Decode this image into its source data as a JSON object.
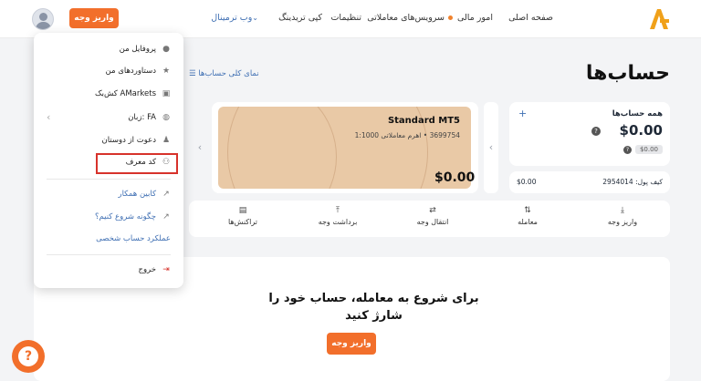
{
  "header": {
    "nav": [
      "صفحه اصلی",
      "امور مالی",
      "سرویس‌های معاملاتی",
      "تنظیمات",
      "کپی تریدینگ",
      "وب ترمینال"
    ],
    "deposit_button": "واریز وجه",
    "accent": "#f26f2b"
  },
  "page": {
    "title": "حساب‌ها",
    "overview_link": "نمای کلی حساب‌ها"
  },
  "accounts_card": {
    "title": "همه حساب‌ها",
    "add": "+",
    "balance": "$0.00",
    "sub_badge": "$0.00"
  },
  "wallet_card": {
    "label": "کیف پول: 2954014",
    "amount": "$0.00"
  },
  "mt5_card": {
    "title": "Standard MT5",
    "subtitle": "3699754 • اهرم معاملاتی 1:1000",
    "balance": "$0.00",
    "card_color": "#e9c9a6"
  },
  "actions": [
    {
      "label": "واریز وجه",
      "icon": "download-icon"
    },
    {
      "label": "معامله",
      "icon": "trade-icon"
    },
    {
      "label": "انتقال وجه",
      "icon": "transfer-icon"
    },
    {
      "label": "برداشت وجه",
      "icon": "upload-icon"
    },
    {
      "label": "تراکنش‌ها",
      "icon": "trash-icon"
    }
  ],
  "empty_state": {
    "message": "برای شروع به معامله، حساب خود را شارژ کنید",
    "button": "واریز وجه"
  },
  "menu": {
    "items": [
      {
        "label": "پروفایل من",
        "icon": "user-icon"
      },
      {
        "label": "دستاوردهای من",
        "icon": "star-icon"
      },
      {
        "label": "کش‌بک AMarkets",
        "icon": "gift-icon"
      },
      {
        "label": "زبان: FA",
        "icon": "globe-icon"
      },
      {
        "label": "دعوت از دوستان",
        "icon": "add-user-icon"
      },
      {
        "label": "کد معرف",
        "icon": "users-icon"
      }
    ],
    "links": [
      "کابین همکار",
      "چگونه شروع کنیم؟",
      "عملکرد حساب شخصی"
    ],
    "logout": "خروج",
    "highlight_color": "#d7322b"
  }
}
